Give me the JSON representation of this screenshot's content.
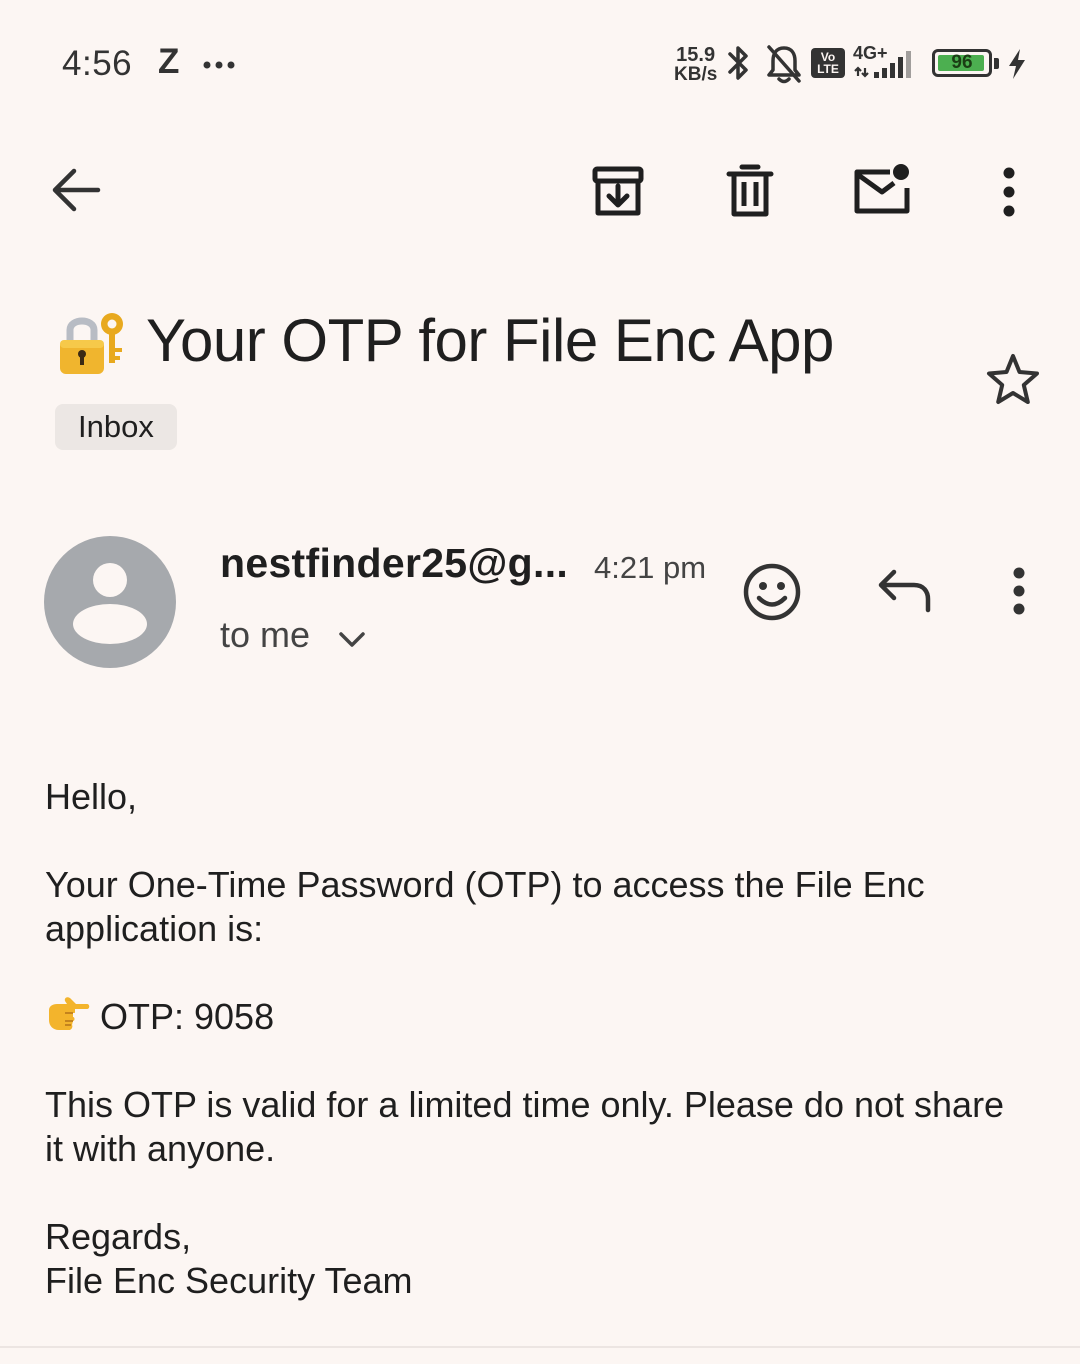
{
  "status_bar": {
    "time": "4:56",
    "z_indicator": "Z",
    "overflow": "•••",
    "net_speed_value": "15.9",
    "net_speed_unit": "KB/s",
    "volte_top": "Vo",
    "volte_bottom": "LTE",
    "network_type": "4G+",
    "battery_level": "96",
    "battery_fill": 0.96,
    "colors": {
      "battery_fill": "#4caf50",
      "icon": "#333333"
    }
  },
  "toolbar": {
    "icons": [
      "back-arrow-icon",
      "archive-icon",
      "delete-icon",
      "mark-unread-icon",
      "more-vertical-icon"
    ]
  },
  "email": {
    "subject_emoji": "🔐",
    "subject": "Your OTP for File Enc App",
    "label": "Inbox",
    "starred": false,
    "sender": "nestfinder25@g...",
    "time": "4:21 pm",
    "recipient": "to me",
    "body": {
      "greeting": "Hello,",
      "line1": "Your One-Time Password (OTP) to access the File Enc",
      "line2": "application is:",
      "otp_emoji": "👉",
      "otp_line": "OTP: 9058",
      "validity_line1": "This OTP is valid for a limited time only. Please do not share",
      "validity_line2": "it with anyone.",
      "signoff": "Regards,",
      "signature": "File Enc Security Team"
    }
  }
}
